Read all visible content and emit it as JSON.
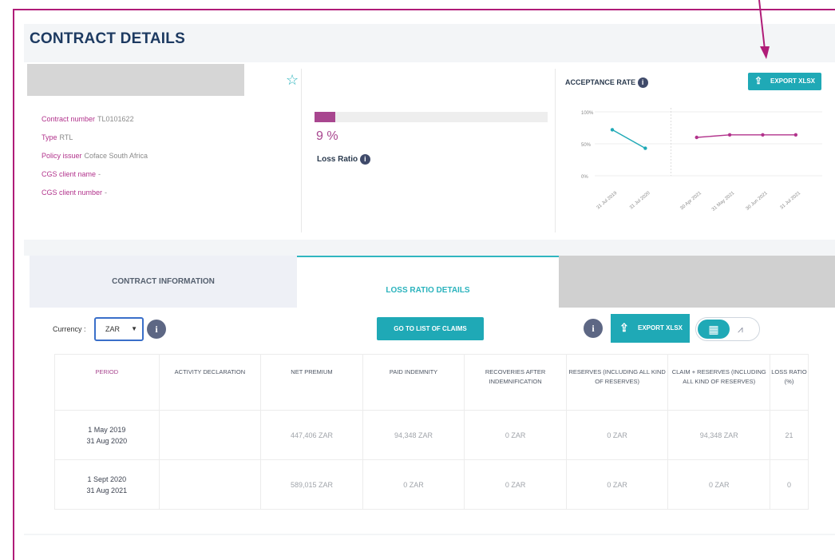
{
  "page": {
    "title": "CONTRACT DETAILS"
  },
  "contract": {
    "rows": [
      {
        "label": "Contract number",
        "value": "TL0101622"
      },
      {
        "label": "Type",
        "value": "RTL"
      },
      {
        "label": "Policy issuer",
        "value": "Coface South Africa"
      },
      {
        "label": "CGS client name",
        "value": "-"
      },
      {
        "label": "CGS client number",
        "value": "-"
      }
    ]
  },
  "loss_ratio": {
    "percent_text": "9 %",
    "label": "Loss Ratio",
    "value_percent": 9
  },
  "acceptance": {
    "title": "ACCEPTANCE RATE",
    "export_label": "EXPORT XLSX"
  },
  "chart_data": {
    "type": "line",
    "title": "ACCEPTANCE RATE",
    "y_ticks": [
      "100%",
      "50%",
      "0%"
    ],
    "ylim": [
      0,
      100
    ],
    "categories": [
      "31 Jul 2019",
      "31 Jul 2020",
      "30 Apr 2021",
      "31 May 2021",
      "30 Jun 2021",
      "31 Jul 2021"
    ],
    "series": [
      {
        "values": [
          72,
          43
        ],
        "color": "#1fa9b6"
      },
      {
        "values": [
          60,
          64,
          64,
          64
        ],
        "color": "#b2338c"
      }
    ],
    "grid": true
  },
  "tabs": [
    {
      "label": "CONTRACT INFORMATION"
    },
    {
      "label": "LOSS RATIO DETAILS"
    }
  ],
  "toolbar": {
    "currency_label": "Currency :",
    "currency_value": "ZAR",
    "go_claims_label": "GO TO LIST OF CLAIMS",
    "export_label": "EXPORT XLSX"
  },
  "table": {
    "headers": [
      "PERIOD",
      "ACTIVITY DECLARATION",
      "NET PREMIUM",
      "PAID INDEMNITY",
      "RECOVERIES AFTER INDEMNIFICATION",
      "RESERVES (INCLUDING ALL KIND OF RESERVES)",
      "CLAIM + RESERVES (INCLUDING ALL KIND OF RESERVES)",
      "LOSS RATIO (%)"
    ],
    "rows": [
      {
        "period_start": "1 May 2019",
        "period_end": "31 Aug 2020",
        "activity": "",
        "net_premium": "447,406 ZAR",
        "paid": "94,348 ZAR",
        "recoveries": "0 ZAR",
        "reserves": "0 ZAR",
        "claim_reserves": "94,348 ZAR",
        "loss_ratio": "21"
      },
      {
        "period_start": "1 Sept 2020",
        "period_end": "31 Aug 2021",
        "activity": "",
        "net_premium": "589,015 ZAR",
        "paid": "0 ZAR",
        "recoveries": "0 ZAR",
        "reserves": "0 ZAR",
        "claim_reserves": "0 ZAR",
        "loss_ratio": "0"
      }
    ]
  }
}
